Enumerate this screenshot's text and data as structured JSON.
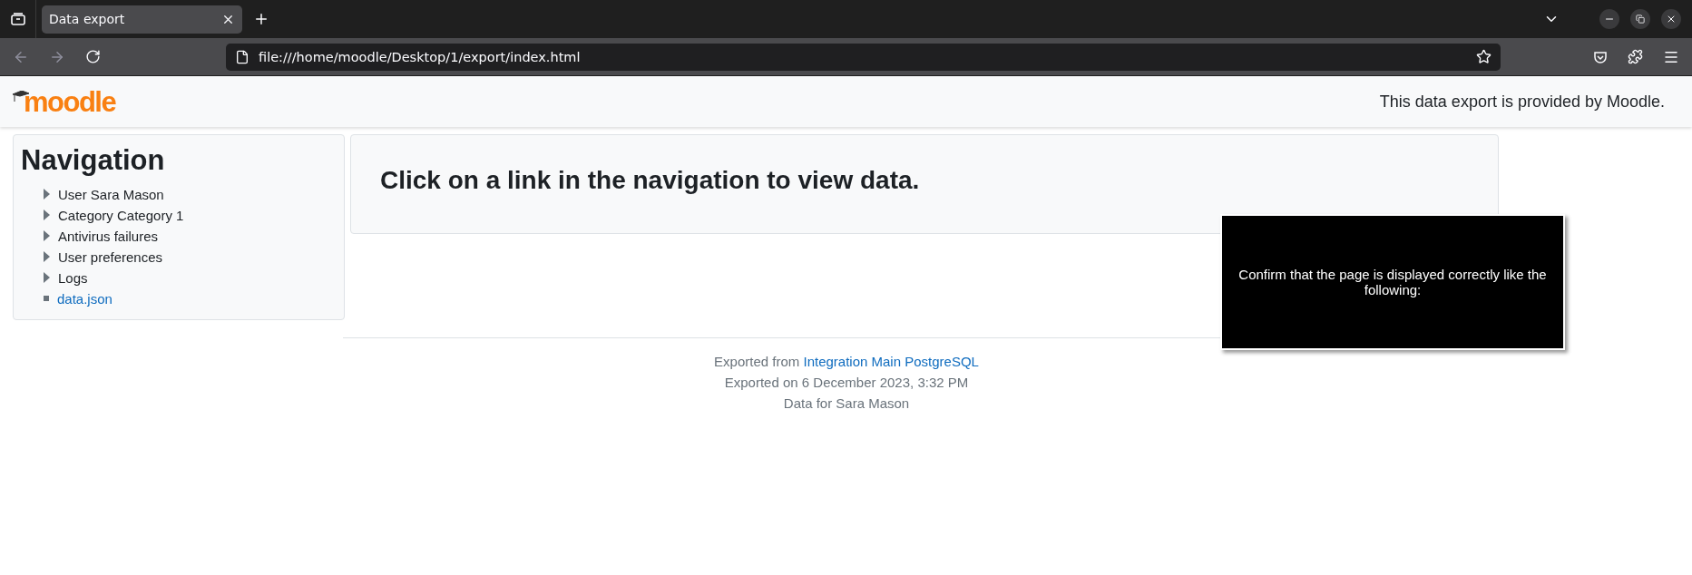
{
  "browser": {
    "tabs": [
      {
        "title": "Data export",
        "selected": true
      }
    ],
    "address": "file:///home/moodle/Desktop/1/export/index.html"
  },
  "header": {
    "logo": "moodle",
    "notice": "This data export is provided by Moodle."
  },
  "navigation": {
    "title": "Navigation",
    "items": [
      {
        "label": "User Sara Mason",
        "kind": "folder"
      },
      {
        "label": "Category Category 1",
        "kind": "folder"
      },
      {
        "label": "Antivirus failures",
        "kind": "folder"
      },
      {
        "label": "User preferences",
        "kind": "folder"
      },
      {
        "label": "Logs",
        "kind": "folder"
      },
      {
        "label": "data.json",
        "kind": "file"
      }
    ]
  },
  "main": {
    "heading": "Click on a link in the navigation to view data."
  },
  "footer": {
    "exported_from": "Exported from",
    "site_link": "Integration Main PostgreSQL",
    "exported_on": "Exported on 6 December 2023, 3:32 PM",
    "data_for": "Data for Sara Mason"
  },
  "overlay": {
    "message": "Confirm that the page is displayed correctly like the following:"
  }
}
